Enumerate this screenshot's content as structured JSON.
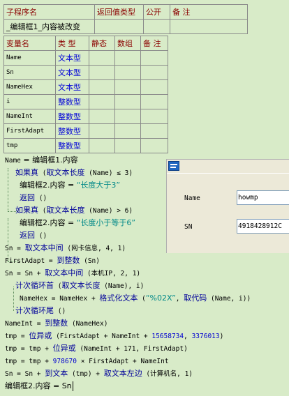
{
  "sub_table": {
    "headers": [
      "子程序名",
      "返回值类型",
      "公开",
      "备 注"
    ],
    "row": [
      "_编辑框1_内容被改变",
      "",
      "",
      ""
    ]
  },
  "var_table": {
    "headers": [
      "变量名",
      "类 型",
      "静态",
      "数组",
      "备 注"
    ],
    "rows": [
      {
        "name": "Name",
        "type": "文本型"
      },
      {
        "name": "Sn",
        "type": "文本型"
      },
      {
        "name": "NameHex",
        "type": "文本型"
      },
      {
        "name": "i",
        "type": "整数型"
      },
      {
        "name": "NameInt",
        "type": "整数型"
      },
      {
        "name": "FirstAdapt",
        "type": "整数型"
      },
      {
        "name": "tmp",
        "type": "整数型"
      }
    ]
  },
  "code": {
    "l1": {
      "a": "Name",
      "b": " = 编辑框1.内容"
    },
    "l2": {
      "a": "如果真",
      "b": " (",
      "c": "取文本长度",
      "d": " (Name) ≤ 3)"
    },
    "l3": {
      "a": "编辑框2.内容 = ",
      "s": "“长度大于3”"
    },
    "l4": {
      "a": "返回",
      "b": " ()"
    },
    "l5": {
      "a": "如果真",
      "b": " (",
      "c": "取文本长度",
      "d": " (Name) > 6)"
    },
    "l6": {
      "a": "编辑框2.内容 = ",
      "s": "“长度小于等于6”"
    },
    "l7": {
      "a": "返回",
      "b": " ()"
    },
    "l8": {
      "a": "Sn",
      "b": " = ",
      "c": "取文本中间",
      "d": " (网卡信息, 4, 1)"
    },
    "l9": {
      "a": "FirstAdapt",
      "b": " = ",
      "c": "到整数",
      "d": " (Sn)"
    },
    "l10": {
      "a": "Sn",
      "b": " = Sn + ",
      "c": "取文本中间",
      "d": " (本机IP, 2, 1)"
    },
    "l11": {
      "a": "计次循环首",
      "b": " (",
      "c": "取文本长度",
      "d": " (Name), i)"
    },
    "l12": {
      "a": "NameHex",
      "b": " = NameHex + ",
      "c": "格式化文本",
      "d": " (",
      "s": "“%02X”",
      "e": ", ",
      "f": "取代码",
      "g": " (Name, i))"
    },
    "l13": {
      "a": "计次循环尾",
      "b": " ()"
    },
    "l14": {
      "a": "NameInt",
      "b": " = ",
      "c": "到整数",
      "d": " (NameHex)"
    },
    "l15": {
      "a": "tmp",
      "b": " = ",
      "c": "位异或",
      "d": " (FirstAdapt + NameInt + ",
      "n1": "15658734",
      "e": ", ",
      "n2": "3376013",
      "f": ")"
    },
    "l16": {
      "a": "tmp",
      "b": " = tmp + ",
      "c": "位异或",
      "d": " (NameInt + 171, FirstAdapt)"
    },
    "l17": {
      "a": "tmp",
      "b": " = tmp + ",
      "n1": "978670",
      "d": " × FirstAdapt + NameInt"
    },
    "l18": {
      "a": "Sn",
      "b": " = Sn + ",
      "c": "到文本",
      "d": " (tmp) + ",
      "e": "取文本左边",
      "f": " (计算机名, 1)"
    },
    "l19": {
      "a": "编辑框2.内容 = Sn"
    }
  },
  "window": {
    "name_label": "Name",
    "name_value": "howmp",
    "sn_label": "SN",
    "sn_value": "4918428912C"
  }
}
